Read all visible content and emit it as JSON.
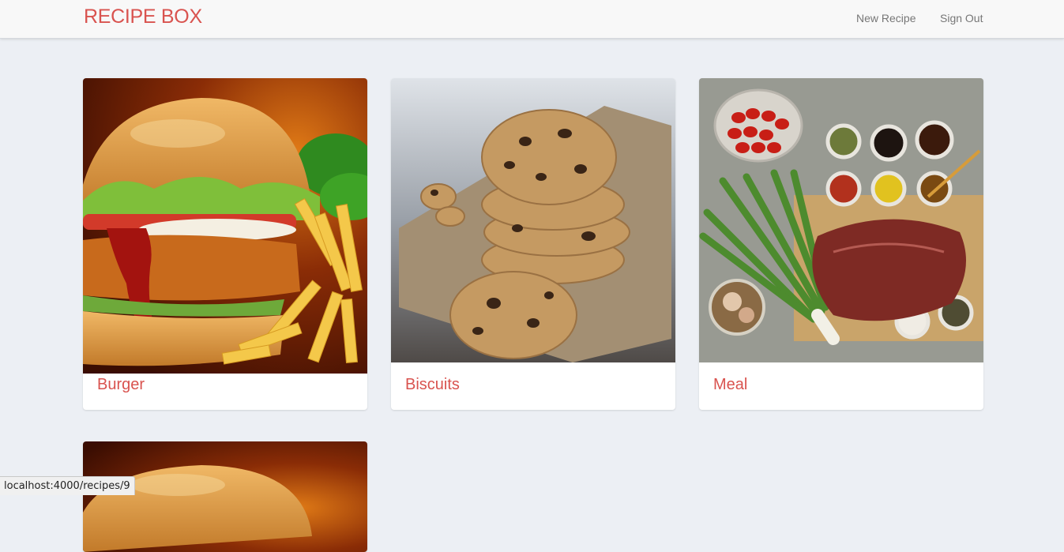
{
  "navbar": {
    "brand": "RECIPE BOX",
    "links": [
      "New Recipe",
      "Sign Out"
    ]
  },
  "recipes": [
    {
      "title": "Burger",
      "image": "burger-photo"
    },
    {
      "title": "Biscuits",
      "image": "cookies-photo"
    },
    {
      "title": "Meal",
      "image": "ingredients-photo"
    },
    {
      "title": "",
      "image": "burger-photo"
    }
  ],
  "status_bar": {
    "url": "localhost:4000/recipes/9"
  },
  "colors": {
    "brand": "#d9534f",
    "background": "#eceff4",
    "navbar": "#f8f8f8"
  }
}
